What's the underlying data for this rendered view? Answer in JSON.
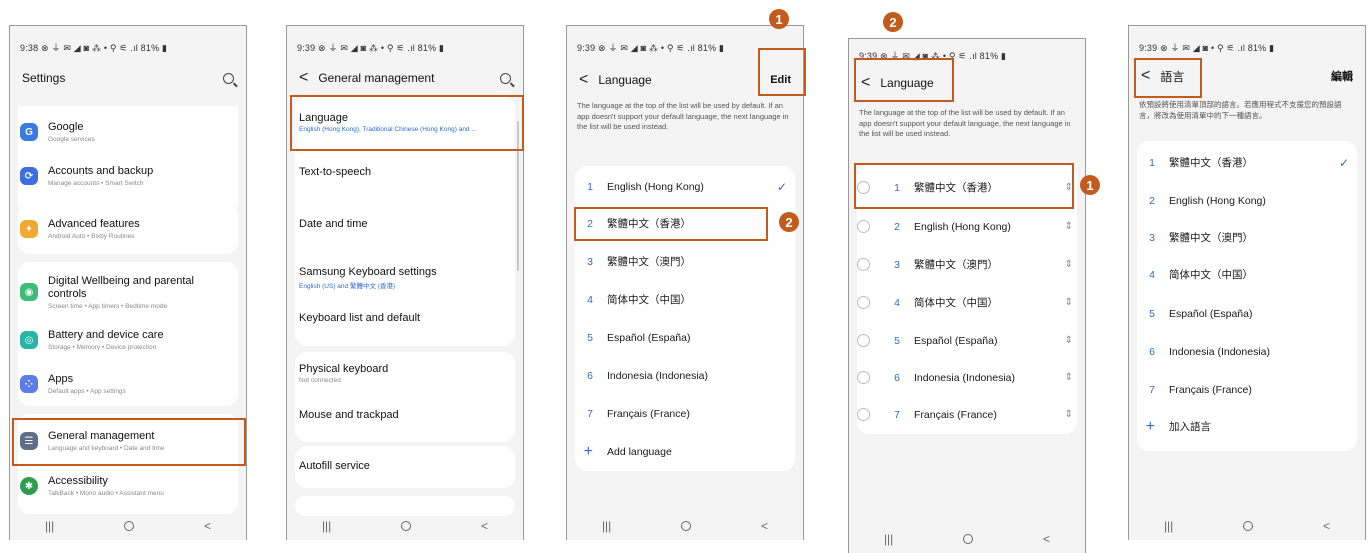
{
  "screens": [
    {
      "status": "9:38 ⊗ ⏚ ✉ ◢ ◙ ⁂ •   ⚲ ⚟ .ıl 81% ▮",
      "title": "Settings",
      "items": [
        {
          "title": "Google",
          "sub": "Google services",
          "icon": "google-icon",
          "color": "#3a7bde",
          "glyph": "G"
        },
        {
          "title": "Accounts and backup",
          "sub": "Manage accounts  •  Smart Switch",
          "icon": "sync-icon",
          "color": "#3a6fe0",
          "glyph": "⟳"
        },
        {
          "title": "Advanced features",
          "sub": "Android Auto  •  Bixby Routines",
          "icon": "gear-plus-icon",
          "color": "#f0a830",
          "glyph": "✦"
        },
        {
          "title": "Digital Wellbeing and parental controls",
          "sub": "Screen time  •  App timers  •  Bedtime mode",
          "icon": "wellbeing-icon",
          "color": "#3dbb78",
          "glyph": "◉"
        },
        {
          "title": "Battery and device care",
          "sub": "Storage  •  Memory  •  Device protection",
          "icon": "device-care-icon",
          "color": "#26b3a8",
          "glyph": "◎"
        },
        {
          "title": "Apps",
          "sub": "Default apps  •  App settings",
          "icon": "apps-icon",
          "color": "#5a7de8",
          "glyph": "⁘"
        },
        {
          "title": "General management",
          "sub": "Language and keyboard  •  Date and time",
          "icon": "general-management-icon",
          "color": "#5f6e86",
          "glyph": "☰"
        },
        {
          "title": "Accessibility",
          "sub": "TalkBack  •  Mono audio  •  Assistant menu",
          "icon": "accessibility-icon",
          "color": "#2e9e4c",
          "glyph": "✱"
        }
      ]
    },
    {
      "status": "9:39 ⊗ ⏚ ✉ ◢ ◙ ⁂ •   ⚲ ⚟ .ıl 81% ▮",
      "title": "General management",
      "language_title": "Language",
      "language_sub": "English (Hong Kong), Traditional Chinese (Hong Kong) and ...",
      "rows": [
        "Text-to-speech",
        "Date and time",
        "Samsung Keyboard settings",
        "Keyboard list and default",
        "Physical keyboard",
        "Mouse and trackpad",
        "Autofill service"
      ],
      "keyboard_sub": "English (US) and 繁體中文 (香港)",
      "physical_sub": "Not connected"
    },
    {
      "status": "9:39 ⊗ ⏚ ✉ ◢ ◙ ⁂ •   ⚲ ⚟ .ıl 81% ▮",
      "title": "Language",
      "action": "Edit",
      "description": "The language at the top of the list will be used by default. If an app doesn't support your default language, the next language in the list will be used instead.",
      "languages": [
        "English (Hong Kong)",
        "繁體中文（香港）",
        "繁體中文（澳門）",
        "简体中文（中国）",
        "Español (España)",
        "Indonesia (Indonesia)",
        "Français (France)"
      ],
      "add": "Add language"
    },
    {
      "status": "9:39 ⊗ ⏚ ✉ ◢ ◙ ⁂ •   ⚲ ⚟ .ıl 81% ▮",
      "title": "Language",
      "description": "The language at the top of the list will be used by default. If an app doesn't support your default language, the next language in the list will be used instead.",
      "languages": [
        "繁體中文（香港）",
        "English (Hong Kong)",
        "繁體中文（澳門）",
        "简体中文（中国）",
        "Español (España)",
        "Indonesia (Indonesia)",
        "Français (France)"
      ]
    },
    {
      "status": "9:39 ⊗ ⏚ ✉ ◢ ◙   •  ⚲ ⚟ .ıl 81% ▮",
      "title": "語言",
      "action": "編輯",
      "description": "依預設將使用清單頂部的語言。若應用程式不支援您的預設語言，將改為使用清單中的下一種語言。",
      "languages": [
        "繁體中文（香港）",
        "English (Hong Kong)",
        "繁體中文（澳門）",
        "简体中文（中国）",
        "Español (España)",
        "Indonesia (Indonesia)",
        "Français (France)"
      ],
      "add": "加入語言"
    }
  ],
  "badges": {
    "one": "1",
    "two": "2"
  },
  "nav": {
    "recents": "|||",
    "back": "<"
  },
  "colors": {
    "highlight": "#c25b1c",
    "accent": "#2f6bd6"
  }
}
